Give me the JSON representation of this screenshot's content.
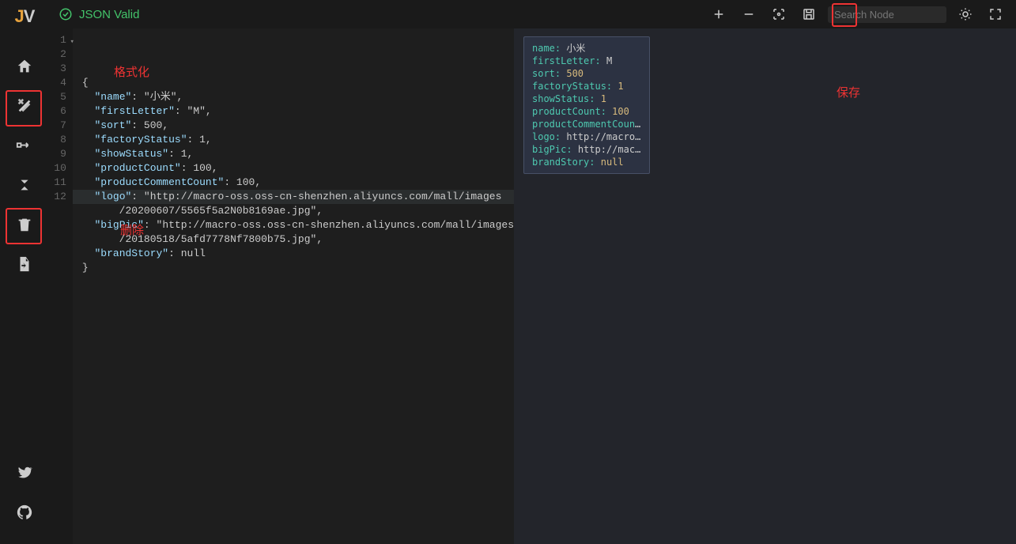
{
  "app": {
    "logo_j": "J",
    "logo_v": "V"
  },
  "status": {
    "label": "JSON Valid"
  },
  "search": {
    "placeholder": "Search Node"
  },
  "annotations": {
    "format": "格式化",
    "delete": "删除",
    "save": "保存"
  },
  "editor": {
    "lines": [
      {
        "n": 1,
        "raw": "{"
      },
      {
        "n": 2,
        "raw": "  \"name\": \"小米\","
      },
      {
        "n": 3,
        "raw": "  \"firstLetter\": \"M\","
      },
      {
        "n": 4,
        "raw": "  \"sort\": 500,"
      },
      {
        "n": 5,
        "raw": "  \"factoryStatus\": 1,"
      },
      {
        "n": 6,
        "raw": "  \"showStatus\": 1,"
      },
      {
        "n": 7,
        "raw": "  \"productCount\": 100,"
      },
      {
        "n": 8,
        "raw": "  \"productCommentCount\": 100,"
      },
      {
        "n": 9,
        "raw": "  \"logo\": \"http://macro-oss.oss-cn-shenzhen.aliyuncs.com/mall/images/20200607/5565f5a2N0b8169ae.jpg\","
      },
      {
        "n": 10,
        "raw": "  \"bigPic\": \"http://macro-oss.oss-cn-shenzhen.aliyuncs.com/mall/images/20180518/5afd7778Nf7800b75.jpg\","
      },
      {
        "n": 11,
        "raw": "  \"brandStory\": null"
      },
      {
        "n": 12,
        "raw": "}"
      }
    ],
    "json_data": {
      "name": "小米",
      "firstLetter": "M",
      "sort": 500,
      "factoryStatus": 1,
      "showStatus": 1,
      "productCount": 100,
      "productCommentCount": 100,
      "logo": "http://macro-oss.oss-cn-shenzhen.aliyuncs.com/mall/images/20200607/5565f5a2N0b8169ae.jpg",
      "bigPic": "http://macro-oss.oss-cn-shenzhen.aliyuncs.com/mall/images/20180518/5afd7778Nf7800b75.jpg",
      "brandStory": null
    }
  },
  "node": {
    "fields": [
      {
        "k": "name",
        "v": "小米",
        "t": "str"
      },
      {
        "k": "firstLetter",
        "v": "M",
        "t": "str"
      },
      {
        "k": "sort",
        "v": "500",
        "t": "num"
      },
      {
        "k": "factoryStatus",
        "v": "1",
        "t": "num"
      },
      {
        "k": "showStatus",
        "v": "1",
        "t": "num"
      },
      {
        "k": "productCount",
        "v": "100",
        "t": "num"
      },
      {
        "k": "productCommentCount",
        "v": "100",
        "t": "num"
      },
      {
        "k": "logo",
        "v": "http://macro-oss.…",
        "t": "str"
      },
      {
        "k": "bigPic",
        "v": "http://macro-os…",
        "t": "str"
      },
      {
        "k": "brandStory",
        "v": "null",
        "t": "null"
      }
    ]
  }
}
